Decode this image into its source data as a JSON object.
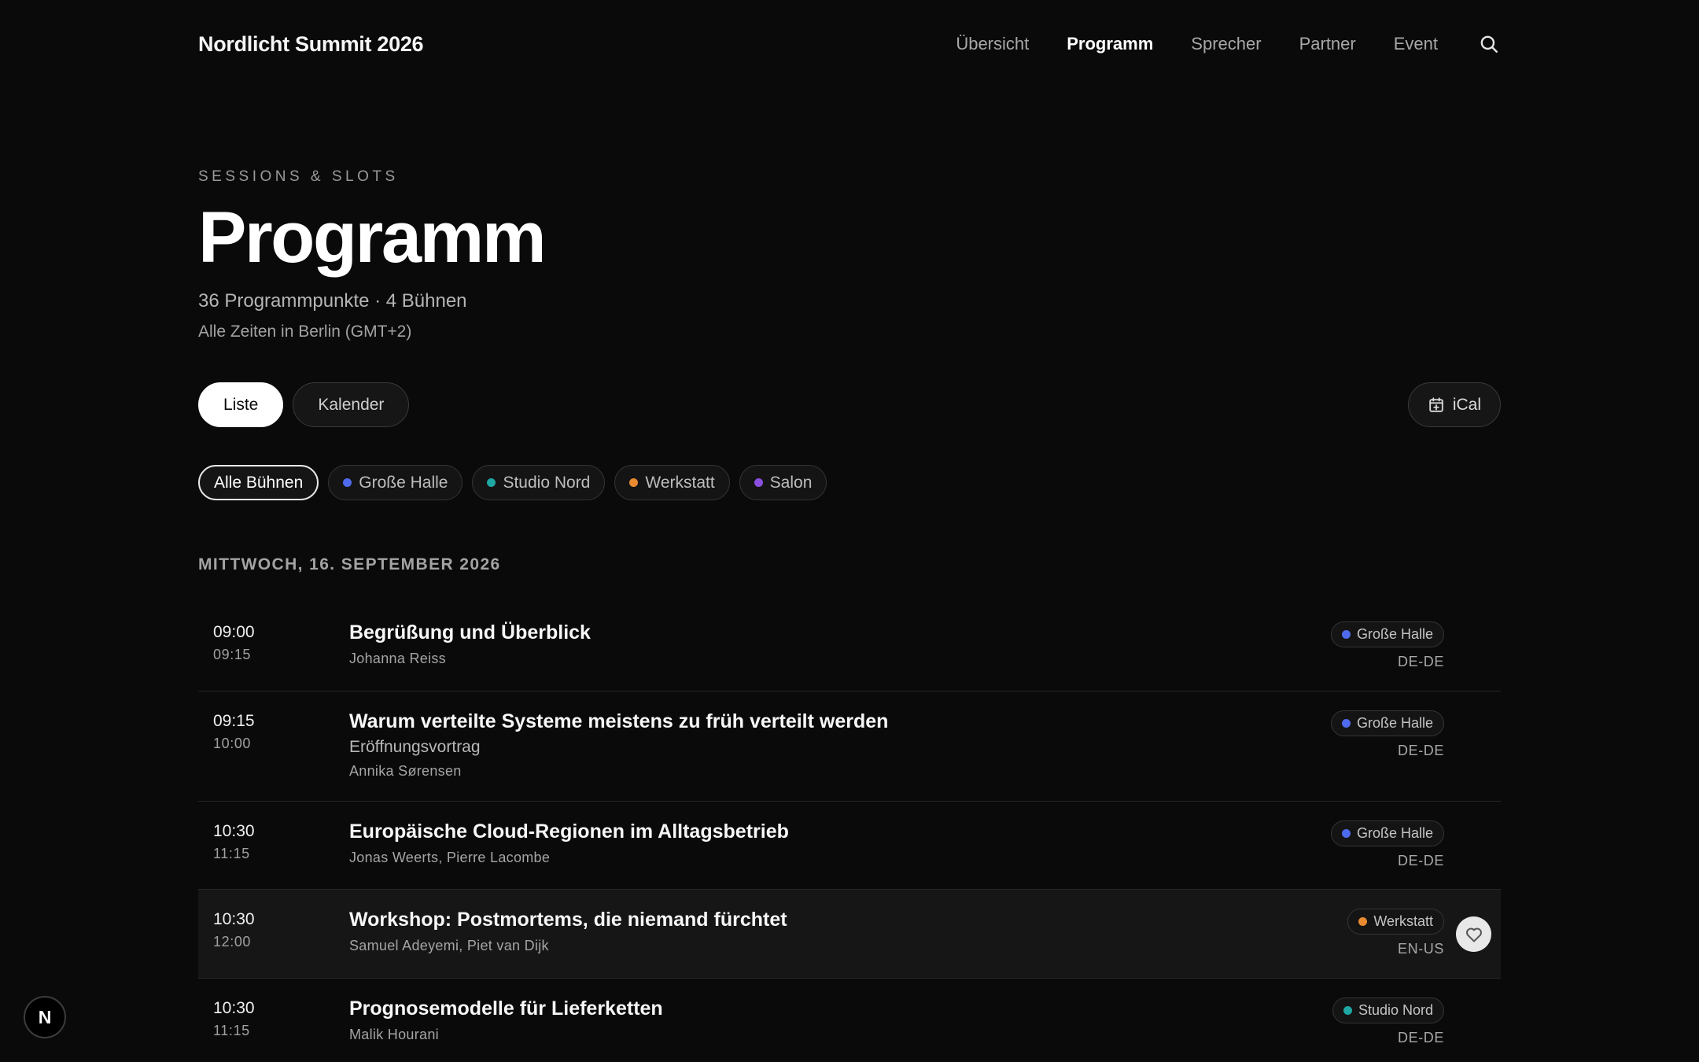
{
  "header": {
    "brand": "Nordlicht Summit 2026",
    "nav": [
      {
        "label": "Übersicht",
        "active": false
      },
      {
        "label": "Programm",
        "active": true
      },
      {
        "label": "Sprecher",
        "active": false
      },
      {
        "label": "Partner",
        "active": false
      },
      {
        "label": "Event",
        "active": false
      }
    ],
    "search_icon": "search-icon"
  },
  "hero": {
    "eyebrow": "SESSIONS & SLOTS",
    "title": "Programm",
    "stats": "36 Programmpunkte · 4 Bühnen",
    "timezone_note": "Alle Zeiten in Berlin (GMT+2)"
  },
  "view_toggle": {
    "list_label": "Liste",
    "calendar_label": "Kalender",
    "selected": "Liste"
  },
  "ical": {
    "label": "iCal",
    "icon": "calendar-plus-icon"
  },
  "filters": [
    {
      "label": "Alle Bühnen",
      "active": true,
      "color": null
    },
    {
      "label": "Große Halle",
      "active": false,
      "color": "#4f6bed"
    },
    {
      "label": "Studio Nord",
      "active": false,
      "color": "#1ea7a3"
    },
    {
      "label": "Werkstatt",
      "active": false,
      "color": "#e88a2f"
    },
    {
      "label": "Salon",
      "active": false,
      "color": "#8b4fe0"
    }
  ],
  "day": {
    "heading": "MITTWOCH, 16. SEPTEMBER 2026",
    "sessions": [
      {
        "start": "09:00",
        "end": "09:15",
        "title": "Begrüßung und Überblick",
        "subtitle": "",
        "speakers": "Johanna Reiss",
        "stage": "Große Halle",
        "stage_color": "#4f6bed",
        "lang": "DE-DE",
        "hovered": false
      },
      {
        "start": "09:15",
        "end": "10:00",
        "title": "Warum verteilte Systeme meistens zu früh verteilt werden",
        "subtitle": "Eröffnungsvortrag",
        "speakers": "Annika Sørensen",
        "stage": "Große Halle",
        "stage_color": "#4f6bed",
        "lang": "DE-DE",
        "hovered": false
      },
      {
        "start": "10:30",
        "end": "11:15",
        "title": "Europäische Cloud-Regionen im Alltagsbetrieb",
        "subtitle": "",
        "speakers": "Jonas Weerts, Pierre Lacombe",
        "stage": "Große Halle",
        "stage_color": "#4f6bed",
        "lang": "DE-DE",
        "hovered": false
      },
      {
        "start": "10:30",
        "end": "12:00",
        "title": "Workshop: Postmortems, die niemand fürchtet",
        "subtitle": "",
        "speakers": "Samuel Adeyemi, Piet van Dijk",
        "stage": "Werkstatt",
        "stage_color": "#e88a2f",
        "lang": "EN-US",
        "hovered": true
      },
      {
        "start": "10:30",
        "end": "11:15",
        "title": "Prognosemodelle für Lieferketten",
        "subtitle": "",
        "speakers": "Malik Hourani",
        "stage": "Studio Nord",
        "stage_color": "#1ea7a3",
        "lang": "DE-DE",
        "hovered": false
      }
    ]
  },
  "favorite_icon": "heart-icon",
  "floating_badge": {
    "label": "N"
  }
}
